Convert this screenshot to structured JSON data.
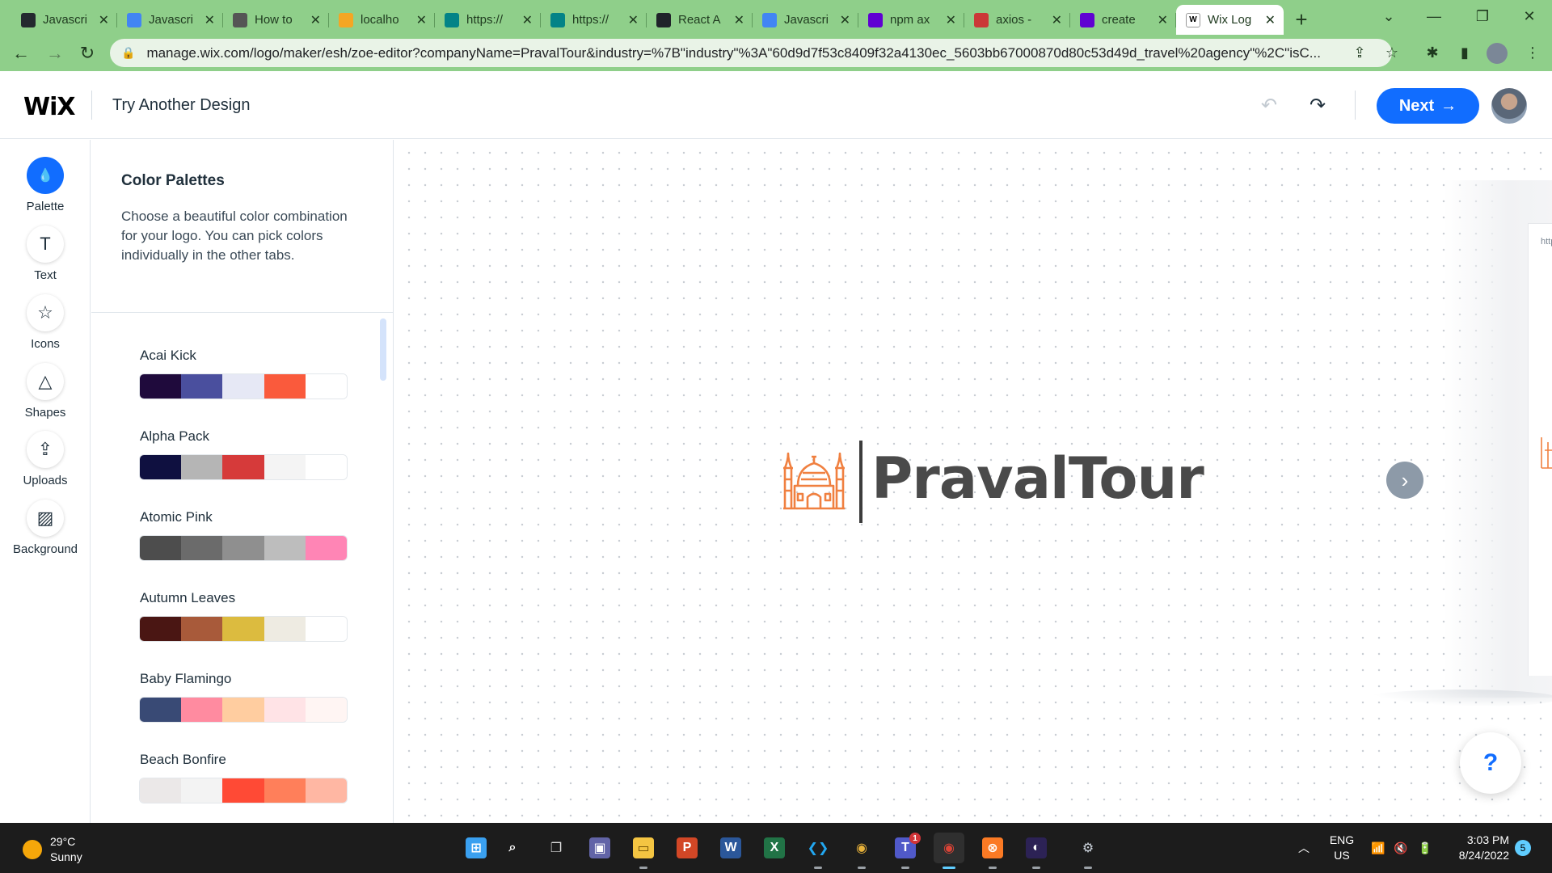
{
  "browser": {
    "tabs": [
      {
        "title": "Javascri",
        "favicon": "github-icon",
        "color": "#24292f"
      },
      {
        "title": "Javascri",
        "favicon": "google-docs-icon",
        "color": "#4285f4"
      },
      {
        "title": "How to",
        "favicon": "site-icon",
        "color": "#555555"
      },
      {
        "title": "localho",
        "favicon": "phpmyadmin-icon",
        "color": "#f5a623"
      },
      {
        "title": "https://",
        "favicon": "sharepoint-icon",
        "color": "#038387"
      },
      {
        "title": "https://",
        "favicon": "sharepoint-icon",
        "color": "#038387"
      },
      {
        "title": "React A",
        "favicon": "react-icon",
        "color": "#20232a"
      },
      {
        "title": "Javascri",
        "favicon": "google-docs-icon",
        "color": "#4285f4"
      },
      {
        "title": "npm ax",
        "favicon": "yahoo-icon",
        "color": "#6001d2"
      },
      {
        "title": "axios -",
        "favicon": "npm-icon",
        "color": "#cb3837"
      },
      {
        "title": "create",
        "favicon": "yahoo-icon",
        "color": "#6001d2"
      },
      {
        "title": "Wix Log",
        "favicon": "wix-icon",
        "color": "#ffffff",
        "active": true
      }
    ],
    "url": "manage.wix.com/logo/maker/esh/zoe-editor?companyName=PravalTour&industry=%7B\"industry\"%3A\"60d9d7f53c8409f32a4130ec_5603bb67000870d80c53d49d_travel%20agency\"%2C\"isC..."
  },
  "header": {
    "logo": "WiX",
    "title": "Try Another Design",
    "next_label": "Next"
  },
  "rail": [
    {
      "label": "Palette",
      "icon": "palette-drop-icon",
      "active": true
    },
    {
      "label": "Text",
      "icon": "text-t-icon"
    },
    {
      "label": "Icons",
      "icon": "star-icon"
    },
    {
      "label": "Shapes",
      "icon": "shapes-icon"
    },
    {
      "label": "Uploads",
      "icon": "upload-icon"
    },
    {
      "label": "Background",
      "icon": "background-hatch-icon"
    }
  ],
  "panel": {
    "title": "Color Palettes",
    "description": "Choose a beautiful color combination for your logo. You can pick colors individually in the other tabs.",
    "palettes": [
      {
        "name": "Acai Kick",
        "colors": [
          "#1f0a3c",
          "#4a4f9e",
          "#e6e8f5",
          "#fa5a3c",
          "#ffffff"
        ]
      },
      {
        "name": "Alpha Pack",
        "colors": [
          "#0f1040",
          "#b5b5b5",
          "#d63a3a",
          "#f4f4f4",
          "#ffffff"
        ]
      },
      {
        "name": "Atomic Pink",
        "colors": [
          "#4d4d4d",
          "#6b6b6b",
          "#8f8f8f",
          "#bdbdbd",
          "#ff85b5"
        ]
      },
      {
        "name": "Autumn Leaves",
        "colors": [
          "#4a1613",
          "#a85a3a",
          "#dcbb3f",
          "#eeebe2",
          "#ffffff"
        ]
      },
      {
        "name": "Baby Flamingo",
        "colors": [
          "#394a75",
          "#ff8ba0",
          "#ffcda0",
          "#ffe3e6",
          "#fff5f3"
        ]
      },
      {
        "name": "Beach Bonfire",
        "colors": [
          "#ebe8e8",
          "#f3f3f3",
          "#ff4a35",
          "#ff7f5a",
          "#ffb7a3"
        ]
      }
    ]
  },
  "canvas": {
    "brand_name": "PravalTour",
    "icon": "mosque-icon",
    "icon_color": "#f08040",
    "preview_url": "https://www"
  },
  "help": {
    "label": "?"
  },
  "taskbar": {
    "weather": {
      "temp": "29°C",
      "condition": "Sunny"
    },
    "apps": [
      "windows-start-icon",
      "search-icon",
      "task-view-icon",
      "teams-chat-icon",
      "file-explorer-icon",
      "powerpoint-icon",
      "word-icon",
      "excel-icon",
      "vscode-icon",
      "chrome-icon",
      "teams-icon",
      "chrome-profile-icon",
      "xampp-icon",
      "eclipse-icon",
      "settings-icon"
    ],
    "teams_badge": "1",
    "language": "ENG",
    "region": "US",
    "time": "3:03 PM",
    "date": "8/24/2022",
    "notifications": "5"
  }
}
